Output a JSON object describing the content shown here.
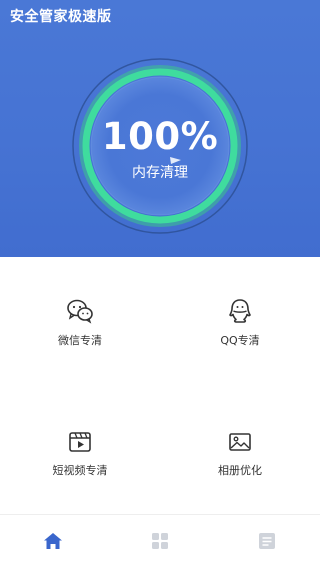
{
  "header": {
    "title": "安全管家极速版"
  },
  "dial": {
    "percent_text": "100%",
    "label": "内存清理",
    "level": 1.0
  },
  "features": [
    {
      "label": "微信专清",
      "icon": "wechat-icon"
    },
    {
      "label": "QQ专清",
      "icon": "qq-icon"
    },
    {
      "label": "短视频专清",
      "icon": "video-icon"
    },
    {
      "label": "相册优化",
      "icon": "photo-icon"
    }
  ],
  "tabbar": {
    "tabs": [
      {
        "icon": "home-icon",
        "active": true
      },
      {
        "icon": "apps-grid-icon",
        "active": false
      },
      {
        "icon": "list-icon",
        "active": false
      }
    ]
  },
  "colors": {
    "brand_blue": "#4673d3",
    "ring_green": "#3fdc9e",
    "active_tab": "#3a66cc",
    "inactive_tab": "#cfd3da"
  }
}
